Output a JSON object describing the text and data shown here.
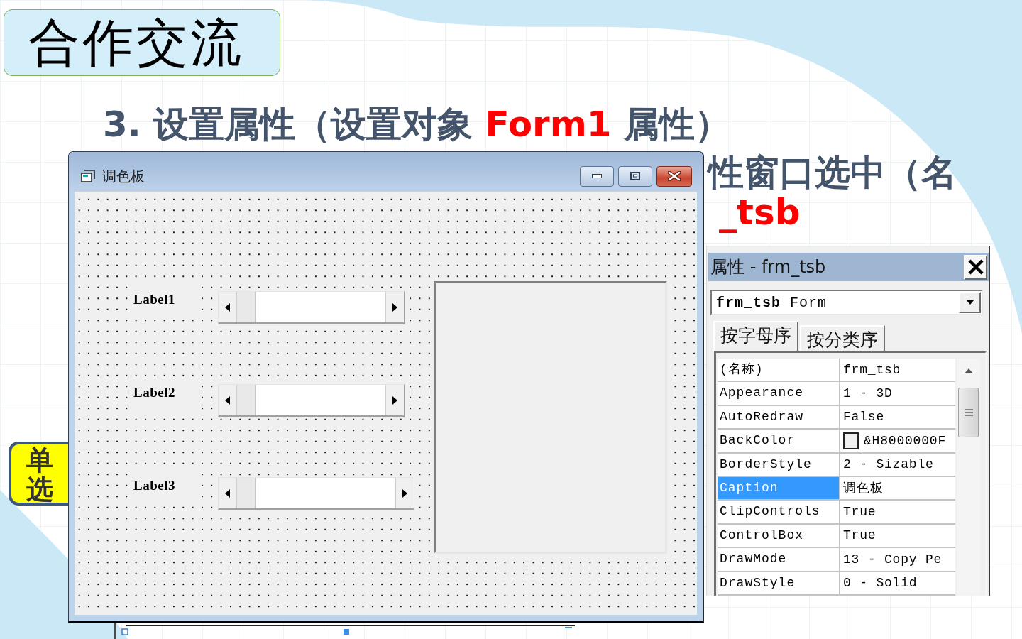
{
  "slide": {
    "title_badge": "合作交流",
    "heading": [
      {
        "text": "3. 设置属性（设置对象 ",
        "highlight": false
      },
      {
        "text": "Form1",
        "highlight": true
      },
      {
        "text": " 属性）",
        "highlight": false
      }
    ],
    "partial_lines": [
      [
        {
          "text": "性窗口选中（名",
          "highlight": false
        }
      ],
      [
        {
          "text": "_tsb",
          "highlight": true
        }
      ]
    ],
    "callout": [
      "单",
      "选"
    ]
  },
  "form_window": {
    "title": "调色板",
    "controls": [
      {
        "label": "Label1"
      },
      {
        "label": "Label2"
      },
      {
        "label": "Label3"
      }
    ]
  },
  "properties_window": {
    "title": "属性 - frm_tsb",
    "object": "**frm_tsb** Form",
    "tabs": [
      {
        "label": "按字母序",
        "selected": true
      },
      {
        "label": "按分类序",
        "selected": false
      }
    ],
    "rows": [
      {
        "name": "(名称)",
        "value": "frm_tsb",
        "kind": "text",
        "selected": false
      },
      {
        "name": "Appearance",
        "value": "1 - 3D",
        "kind": "text",
        "selected": false
      },
      {
        "name": "AutoRedraw",
        "value": "False",
        "kind": "text",
        "selected": false
      },
      {
        "name": "BackColor",
        "value": "&H8000000F",
        "kind": "color",
        "selected": false
      },
      {
        "name": "BorderStyle",
        "value": "2 - Sizable",
        "kind": "text",
        "selected": false
      },
      {
        "name": "Caption",
        "value": "调色板",
        "kind": "text",
        "selected": true
      },
      {
        "name": "ClipControls",
        "value": "True",
        "kind": "text",
        "selected": false
      },
      {
        "name": "ControlBox",
        "value": "True",
        "kind": "text",
        "selected": false
      },
      {
        "name": "DrawMode",
        "value": "13 - Copy Pe",
        "kind": "text",
        "selected": false
      },
      {
        "name": "DrawStyle",
        "value": "0 - Solid",
        "kind": "text",
        "selected": false
      }
    ]
  }
}
